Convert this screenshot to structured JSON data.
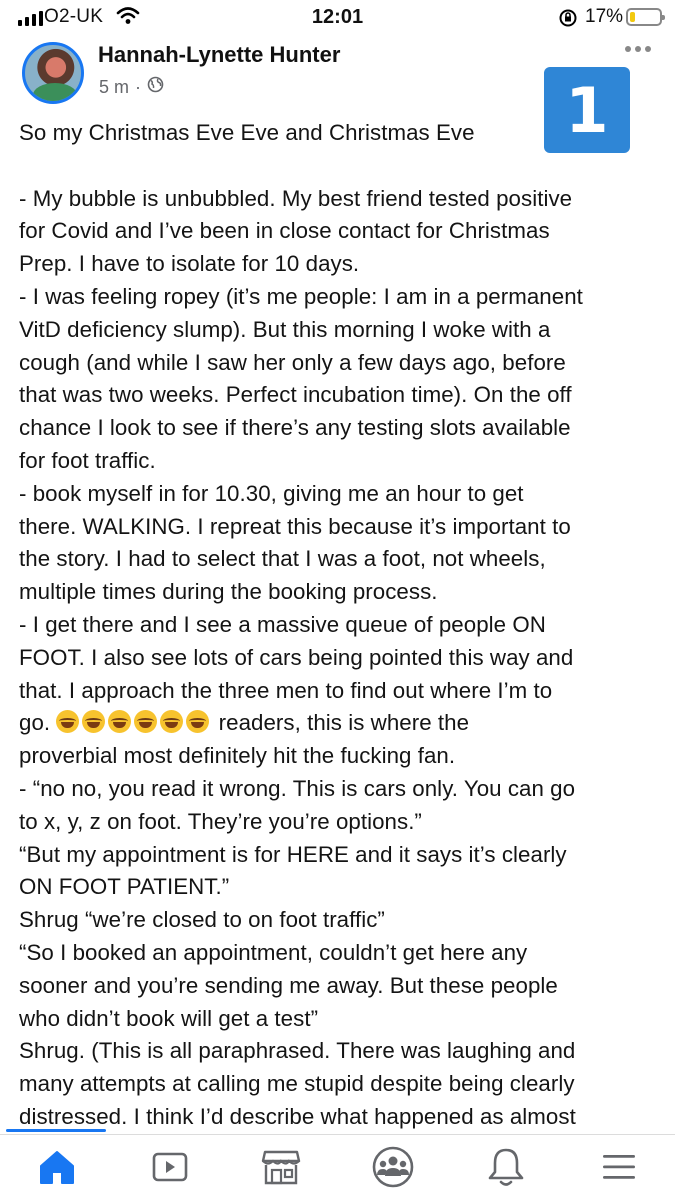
{
  "status_bar": {
    "carrier": "O2-UK",
    "time": "12:01",
    "battery_percent": "17%",
    "battery_level": 0.17,
    "battery_color": "#f2c90f"
  },
  "post": {
    "author": "Hannah-Lynette Hunter",
    "time_ago": "5 m",
    "separator": "·",
    "audience_icon": "globe-icon",
    "badge_number": "1",
    "badge_color": "#2f86d6",
    "lines": [
      "So my Christmas Eve Eve and Christmas Eve",
      "",
      "- My bubble is unbubbled. My best friend tested positive",
      "for Covid and I’ve been in close contact for Christmas",
      "Prep. I have to isolate for 10 days.",
      "- I was feeling ropey (it’s me people: I am in a permanent",
      "VitD deficiency slump). But this morning I woke with a",
      "cough (and while I saw her only a few days ago, before",
      "that was two weeks. Perfect incubation time). On the off",
      "chance I look to see if there’s any testing slots available",
      "for foot traffic.",
      "- book myself in for 10.30, giving me an hour to get",
      "there. WALKING. I repreat this because it’s important to",
      "the story. I had to select that I was a foot, not wheels,",
      "multiple times during the booking process.",
      "- I get there and I see a massive queue of people ON",
      "FOOT. I also see lots of cars being pointed this way and",
      "that. I approach the three men to find out where I’m to",
      "go.",
      "proverbial most definitely hit the fucking fan.",
      "- “no no, you read it wrong. This is cars only. You can go",
      "to x, y, z on foot. They’re you’re options.”",
      "“But my appointment is for HERE and it says it’s clearly",
      "ON FOOT PATIENT.”",
      "Shrug “we’re closed to on foot traffic”",
      "“So I booked an appointment, couldn’t get here any",
      "sooner and you’re sending me away. But these people",
      "who didn’t book will get a test”",
      "Shrug. (This is all paraphrased. There was laughing and",
      "many attempts at calling me stupid despite being clearly",
      "distressed. I think I’d describe what happened as almost"
    ],
    "emoji_line_suffix": " readers, this is where the",
    "emoji_count": 6,
    "emoji_name": "rolling-on-floor-laughing-emoji"
  },
  "bottom_nav": {
    "items": [
      "home-icon",
      "watch-icon",
      "marketplace-icon",
      "groups-icon",
      "notifications-icon",
      "menu-icon"
    ],
    "active": "home-icon",
    "active_color": "#1877f2",
    "inactive_color": "#65676b"
  }
}
